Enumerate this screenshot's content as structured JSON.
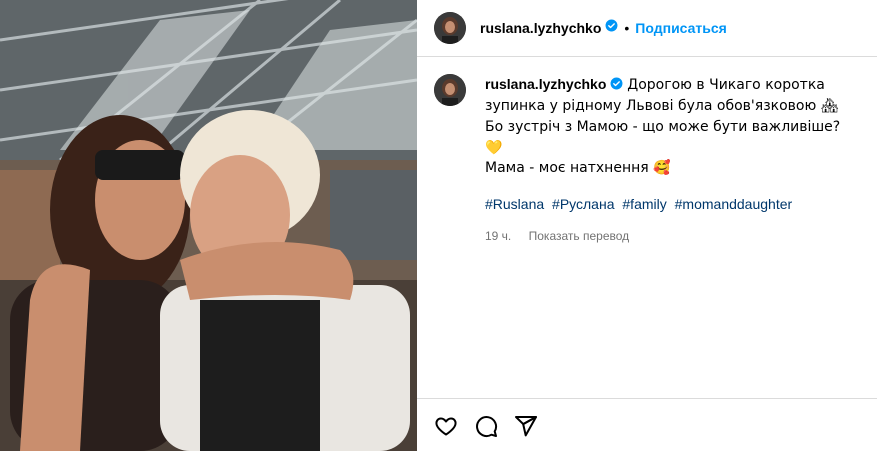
{
  "post": {
    "image_alt": "photo",
    "author": {
      "username": "ruslana.lyzhychko",
      "verified": true
    },
    "header": {
      "separator": "•",
      "follow_label": "Подписаться"
    },
    "caption": {
      "text": "Дорогою в Чикаго коротка зупинка у рідному Львові була обов'язковою 🏘 Бо зустріч з Мамою - що може бути важливіше? 💛",
      "line2": "Мама - моє натхнення 🥰",
      "hashtags": [
        "#Ruslana",
        "#Руслана",
        "#family",
        "#momanddaughter"
      ]
    },
    "meta": {
      "time": "19 ч.",
      "translate_label": "Показать перевод"
    },
    "actions": {
      "like_icon": "heart-icon",
      "comment_icon": "comment-icon",
      "share_icon": "share-icon"
    },
    "colors": {
      "accent": "#0095f6",
      "hashtag": "#00376b",
      "muted": "#737373",
      "border": "#dbdbdb"
    }
  }
}
